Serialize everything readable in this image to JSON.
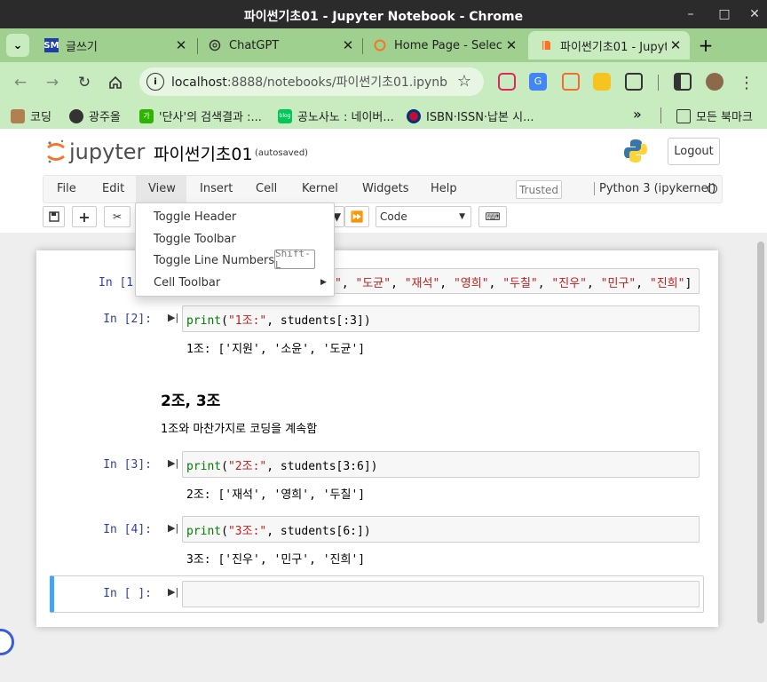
{
  "window": {
    "title": "파이썬기초01 - Jupyter Notebook - Chrome",
    "minimize": "–",
    "maximize": "□",
    "close": "✕"
  },
  "tabs": [
    {
      "label": "글쓰기",
      "favicon": "SM",
      "active": false
    },
    {
      "label": "ChatGPT",
      "favicon": "chatgpt-icon",
      "active": false
    },
    {
      "label": "Home Page - Select",
      "favicon": "jupyter-icon",
      "active": false
    },
    {
      "label": "파이썬기초01 - Jupyt",
      "favicon": "notebook-icon",
      "active": true
    }
  ],
  "tab_controls": {
    "list": "⌄",
    "close": "✕",
    "new": "+"
  },
  "address": {
    "host": "localhost",
    "rest": ":8888/notebooks/파이썬기초01.ipynb"
  },
  "bookmarks": [
    {
      "label": "코딩",
      "icon": "dog-icon"
    },
    {
      "label": "광주올",
      "icon": "gear-icon"
    },
    {
      "label": "'단사'의 검색결과 :...",
      "icon": "naver-icon"
    },
    {
      "label": "공노사노 : 네이버...",
      "icon": "blog-icon"
    },
    {
      "label": "ISBN·ISSN·납본 시...",
      "icon": "korea-icon"
    }
  ],
  "bookmarks_more": "»",
  "all_bookmarks": "모든 북마크",
  "jupyter": {
    "logo_text": "jupyter",
    "notebook_name": "파이썬기초01",
    "autosaved": "(autosaved)",
    "logout": "Logout"
  },
  "menu": {
    "file": "File",
    "edit": "Edit",
    "view": "View",
    "insert": "Insert",
    "cell": "Cell",
    "kernel": "Kernel",
    "widgets": "Widgets",
    "help": "Help",
    "trusted": "Trusted",
    "kernel_name": "Python 3 (ipykernel)"
  },
  "cell_type": "Code",
  "view_menu": {
    "toggle_header": "Toggle Header",
    "toggle_toolbar": "Toggle Toolbar",
    "toggle_line_numbers": "Toggle Line Numbers",
    "shortcut": "Shift-L",
    "cell_toolbar": "Cell Toolbar"
  },
  "cells": {
    "c1": {
      "prompt": "In [1",
      "tail": [
        "\"도균\"",
        ", ",
        "\"재석\"",
        ", ",
        "\"영희\"",
        ", ",
        "\"두칠\"",
        ", ",
        "\"진우\"",
        ", ",
        "\"민구\"",
        ", ",
        "\"진희\"",
        "]"
      ],
      "partial": "\""
    },
    "c2": {
      "prompt": "In [2]:",
      "fn": "print",
      "arg": "\"1조:\"",
      "rest": ", students[:3])",
      "out": "1조: ['지원', '소윤', '도균']"
    },
    "md": {
      "heading": "2조, 3조",
      "text": "1조와 마찬가지로 코딩을 계속함"
    },
    "c3": {
      "prompt": "In [3]:",
      "fn": "print",
      "arg": "\"2조:\"",
      "rest": ", students[3:6])",
      "out": "2조: ['재석', '영희', '두칠']"
    },
    "c4": {
      "prompt": "In [4]:",
      "fn": "print",
      "arg": "\"3조:\"",
      "rest": ", students[6:])",
      "out": "3조: ['진우', '민구', '진희']"
    },
    "c5": {
      "prompt": "In [ ]:"
    }
  }
}
